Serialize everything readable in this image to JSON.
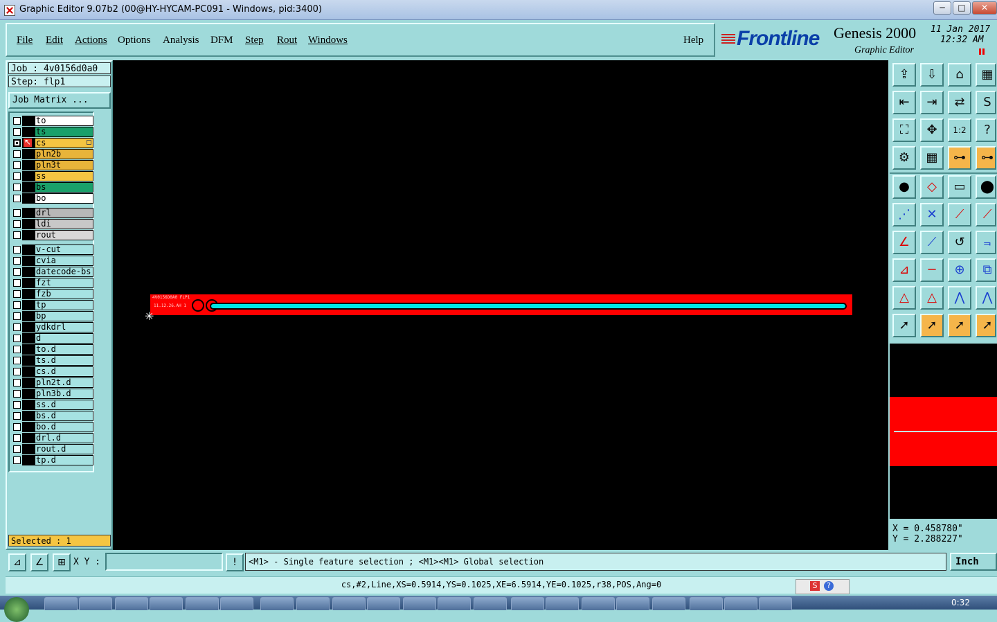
{
  "window": {
    "title": "Graphic Editor 9.07b2 (00@HY-HYCAM-PC091 - Windows, pid:3400)",
    "minimize": "─",
    "maximize": "□",
    "close": "✕"
  },
  "menu": {
    "items": [
      {
        "label": "File"
      },
      {
        "label": "Edit"
      },
      {
        "label": "Actions"
      },
      {
        "label": "Options"
      },
      {
        "label": "Analysis"
      },
      {
        "label": "DFM"
      },
      {
        "label": "Step"
      },
      {
        "label": "Rout"
      },
      {
        "label": "Windows"
      }
    ],
    "help": "Help"
  },
  "brand": {
    "logo": "Frontline",
    "product": "Genesis 2000",
    "subtitle": "Graphic Editor",
    "date": "11 Jan 2017",
    "time": "12:32 AM"
  },
  "job": {
    "job_line": "Job : 4v0156d0a0",
    "step_line": "Step: flp1",
    "matrix_button": "Job Matrix ...",
    "selected": "Selected : 1"
  },
  "layers": {
    "group1": [
      {
        "name": "to",
        "color": "#ffffff",
        "active": false
      },
      {
        "name": "ts",
        "color": "#1aa06a",
        "active": false
      },
      {
        "name": "cs",
        "color": "#f5c542",
        "active": true
      },
      {
        "name": "pln2b",
        "color": "#e8b43a",
        "active": false
      },
      {
        "name": "pln3t",
        "color": "#e8b43a",
        "active": false
      },
      {
        "name": "ss",
        "color": "#f5c542",
        "active": false
      },
      {
        "name": "bs",
        "color": "#1aa06a",
        "active": false
      },
      {
        "name": "bo",
        "color": "#ffffff",
        "active": false
      }
    ],
    "group2": [
      {
        "name": "drl",
        "color": "#b8b8b8"
      },
      {
        "name": "ldi",
        "color": "#c8c8c8"
      },
      {
        "name": "rout",
        "color": "#d8d8d8"
      }
    ],
    "group3": [
      {
        "name": "v-cut"
      },
      {
        "name": "cvia"
      },
      {
        "name": "datecode-bs"
      },
      {
        "name": "fzt"
      },
      {
        "name": "fzb"
      },
      {
        "name": "tp"
      },
      {
        "name": "bp"
      },
      {
        "name": "ydkdrl"
      },
      {
        "name": "d"
      },
      {
        "name": "to.d"
      },
      {
        "name": "ts.d"
      },
      {
        "name": "cs.d"
      },
      {
        "name": "pln2t.d"
      },
      {
        "name": "pln3b.d"
      },
      {
        "name": "ss.d"
      },
      {
        "name": "bs.d"
      },
      {
        "name": "bo.d"
      },
      {
        "name": "drl.d"
      },
      {
        "name": "rout.d"
      },
      {
        "name": "tp.d"
      }
    ],
    "group3_color": "#a6e2e2"
  },
  "canvas": {
    "board_text_1": "4V0156D0A0 FLP1",
    "board_text_2": "11.12.26.AH 1"
  },
  "coords": {
    "x": "X = 0.458780\"",
    "y": "Y = 2.288227\""
  },
  "command": {
    "xy_label": "X Y :",
    "xy_value": "",
    "hint": "<M1> - Single feature selection ; <M1><M1> Global selection",
    "units": "Inch"
  },
  "status": {
    "feature_info": "cs,#2,Line,XS=0.5914,YS=0.1025,XE=6.5914,YE=0.1025,r38,POS,Ang=0"
  },
  "taskbar": {
    "clock": "0:32"
  },
  "colors": {
    "panel": "#9fdada",
    "board": "#ff0000",
    "trace": "#00e5e5",
    "selected_bg": "#f5c542"
  },
  "tool_icons": [
    "open-icon",
    "save-icon",
    "home-icon",
    "window-icon",
    "move-left-icon",
    "move-right-icon",
    "swap-icon",
    "snap-icon",
    "zoom-fit-icon",
    "zoom-center-icon",
    "scale-1-2-icon",
    "help-icon",
    "settings-icon",
    "grid-icon",
    "net-icon",
    "net2-icon",
    "pad-icon",
    "shape-icon",
    "ruler-icon",
    "circle-icon",
    "connect-icon",
    "delete-node-icon",
    "line-point-icon",
    "line-point2-icon",
    "angle-icon",
    "line-icon",
    "arc-icon",
    "bracket-icon",
    "polygon-icon",
    "cut-line-icon",
    "center-icon",
    "group-icon",
    "triangle-icon",
    "triangle2-icon",
    "arch-icon",
    "arch2-icon",
    "select-icon",
    "select2-icon",
    "select3-icon",
    "select4-icon"
  ]
}
